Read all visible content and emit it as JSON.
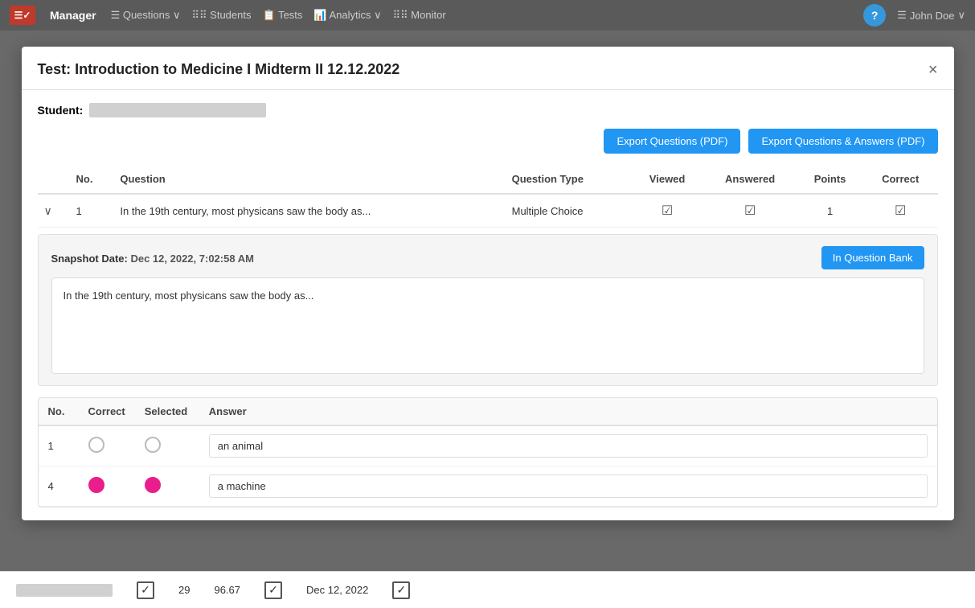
{
  "topbar": {
    "brand": "Manager",
    "nav_items": [
      {
        "label": "Questions",
        "has_arrow": true
      },
      {
        "label": "Students",
        "has_arrow": false
      },
      {
        "label": "Tests",
        "has_arrow": false
      },
      {
        "label": "Analytics",
        "has_arrow": true
      },
      {
        "label": "Monitor",
        "has_arrow": false
      }
    ],
    "help_label": "?",
    "user_label": "John Doe"
  },
  "modal": {
    "title": "Test: Introduction to Medicine I Midterm II 12.12.2022",
    "close_label": "×",
    "student_label": "Student:",
    "export_pdf_label": "Export Questions (PDF)",
    "export_qa_label": "Export Questions & Answers (PDF)",
    "table": {
      "headers": [
        "",
        "No.",
        "Question",
        "Question Type",
        "Viewed",
        "Answered",
        "Points",
        "Correct"
      ],
      "rows": [
        {
          "expand": "∨",
          "no": "1",
          "question": "In the 19th century, most physicans saw the body as...",
          "question_type": "Multiple Choice",
          "viewed": true,
          "answered": true,
          "points": "1",
          "correct": true
        }
      ]
    },
    "detail": {
      "snapshot_label": "Snapshot Date:",
      "snapshot_date": "Dec 12, 2022, 7:02:58 AM",
      "in_bank_label": "In Question Bank",
      "question_text": "In the 19th century, most physicans saw the body as...",
      "answers_table": {
        "headers": [
          "No.",
          "Correct",
          "Selected",
          "Answer"
        ],
        "rows": [
          {
            "no": "1",
            "correct": false,
            "selected": false,
            "answer": "an animal"
          },
          {
            "no": "4",
            "correct": true,
            "selected": true,
            "answer": "a machine"
          }
        ]
      }
    }
  },
  "status_bar": {
    "checkbox_viewed": "✓",
    "score": "29",
    "percent": "96.67",
    "checkbox_correct": "✓",
    "date": "Dec 12, 2022",
    "checkbox_final": "✓"
  }
}
